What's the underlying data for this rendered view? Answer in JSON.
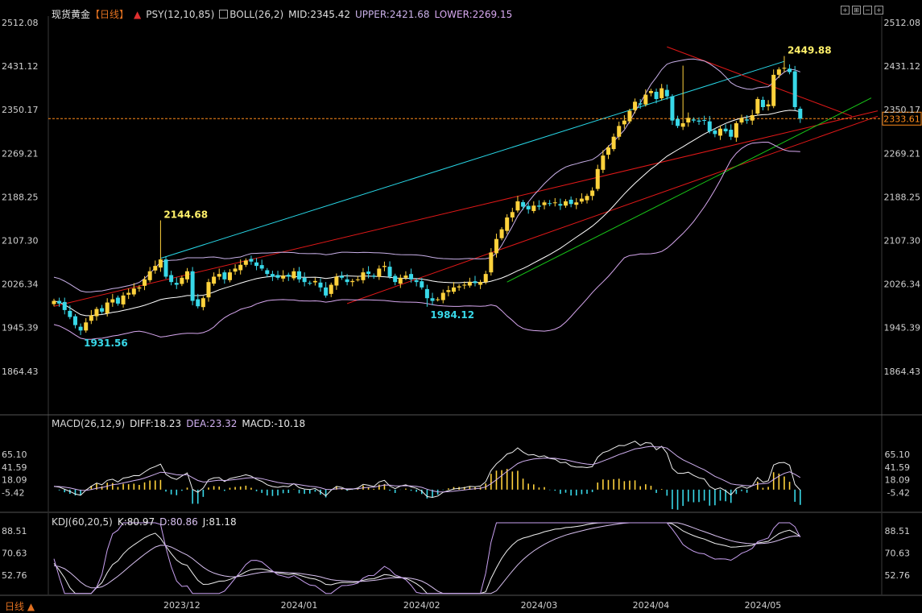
{
  "header": {
    "title": "现货黄金",
    "period": "【日线】",
    "psy": "PSY(12,10,85)",
    "boll": "BOLL(26,2)",
    "mid": "MID:2345.42",
    "upper": "UPPER:2421.68",
    "lower": "LOWER:2269.15"
  },
  "macd_header": {
    "name": "MACD(26,12,9)",
    "diff": "DIFF:18.23",
    "dea": "DEA:23.32",
    "macd": "MACD:-10.18"
  },
  "kdj_header": {
    "name": "KDJ(60,20,5)",
    "k": "K:80.97",
    "d": "D:80.86",
    "j": "J:81.18"
  },
  "bottom_tab": "日线",
  "colors": {
    "up": "#ffd23c",
    "down": "#38d8e8",
    "upper": "#c9b0e8",
    "mid": "#ffffff",
    "lower": "#d8a8f0",
    "red_line": "#e01818",
    "cyan_line": "#28d8e8",
    "green_line": "#18c818",
    "price_line": "#ff8c1a"
  },
  "chart_data": [
    {
      "type": "candlestick",
      "title": "现货黄金 日线",
      "y_ticks": [
        "2512.08",
        "2431.12",
        "2350.17",
        "2269.21",
        "2188.25",
        "2107.30",
        "2026.34",
        "1945.39",
        "1864.43"
      ],
      "ylim": [
        1830,
        2512.08
      ],
      "x_ticks": [
        "2023/12",
        "2024/01",
        "2024/02",
        "2024/03",
        "2024/04",
        "2024/05"
      ],
      "last_price": "2333.61",
      "annotations": [
        {
          "label": "2144.68",
          "index": 20,
          "value": 2144.68
        },
        {
          "label": "1931.56",
          "index": 5,
          "value": 1931.56
        },
        {
          "label": "1984.12",
          "index": 70,
          "value": 1984.12
        },
        {
          "label": "2449.88",
          "index": 137,
          "value": 2449.88
        }
      ]
    },
    {
      "type": "bar",
      "title": "MACD(26,12,9)",
      "y_ticks": [
        "65.10",
        "41.59",
        "18.09",
        "-5.42"
      ],
      "ylim": [
        -20,
        75
      ]
    },
    {
      "type": "line",
      "title": "KDJ(60,20,5)",
      "y_ticks": [
        "88.51",
        "70.63",
        "52.76"
      ],
      "ylim": [
        40,
        95
      ]
    }
  ]
}
